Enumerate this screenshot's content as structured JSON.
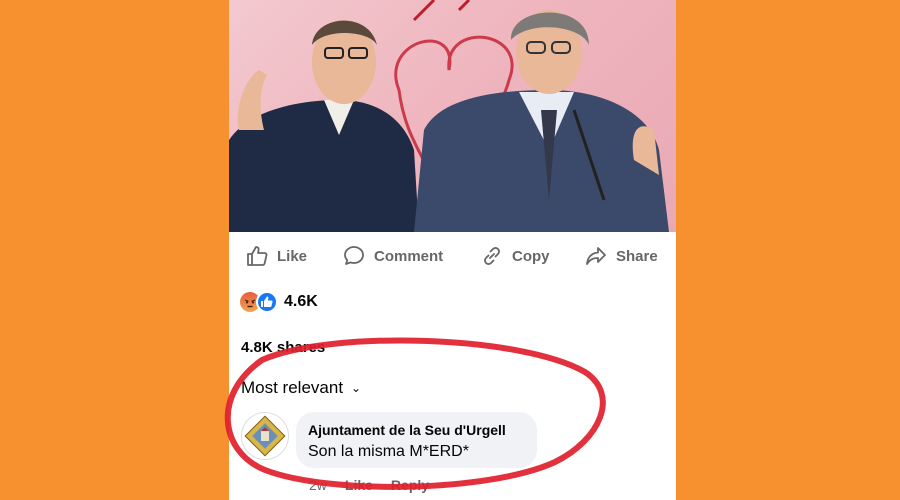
{
  "actions": {
    "like": "Like",
    "comment": "Comment",
    "copy": "Copy",
    "share": "Share"
  },
  "reactions": {
    "count": "4.6K",
    "types": [
      "angry",
      "like"
    ]
  },
  "shares": "4.8K shares",
  "sort_label": "Most relevant",
  "comment": {
    "author": "Ajuntament de la Seu d'Urgell",
    "text": "Son la misma M*ERD*",
    "time": "2w",
    "like_label": "Like",
    "reply_label": "Reply"
  },
  "colors": {
    "background": "#f7912f",
    "annotation_circle": "#e0202c",
    "link_blue": "#1877f2"
  }
}
